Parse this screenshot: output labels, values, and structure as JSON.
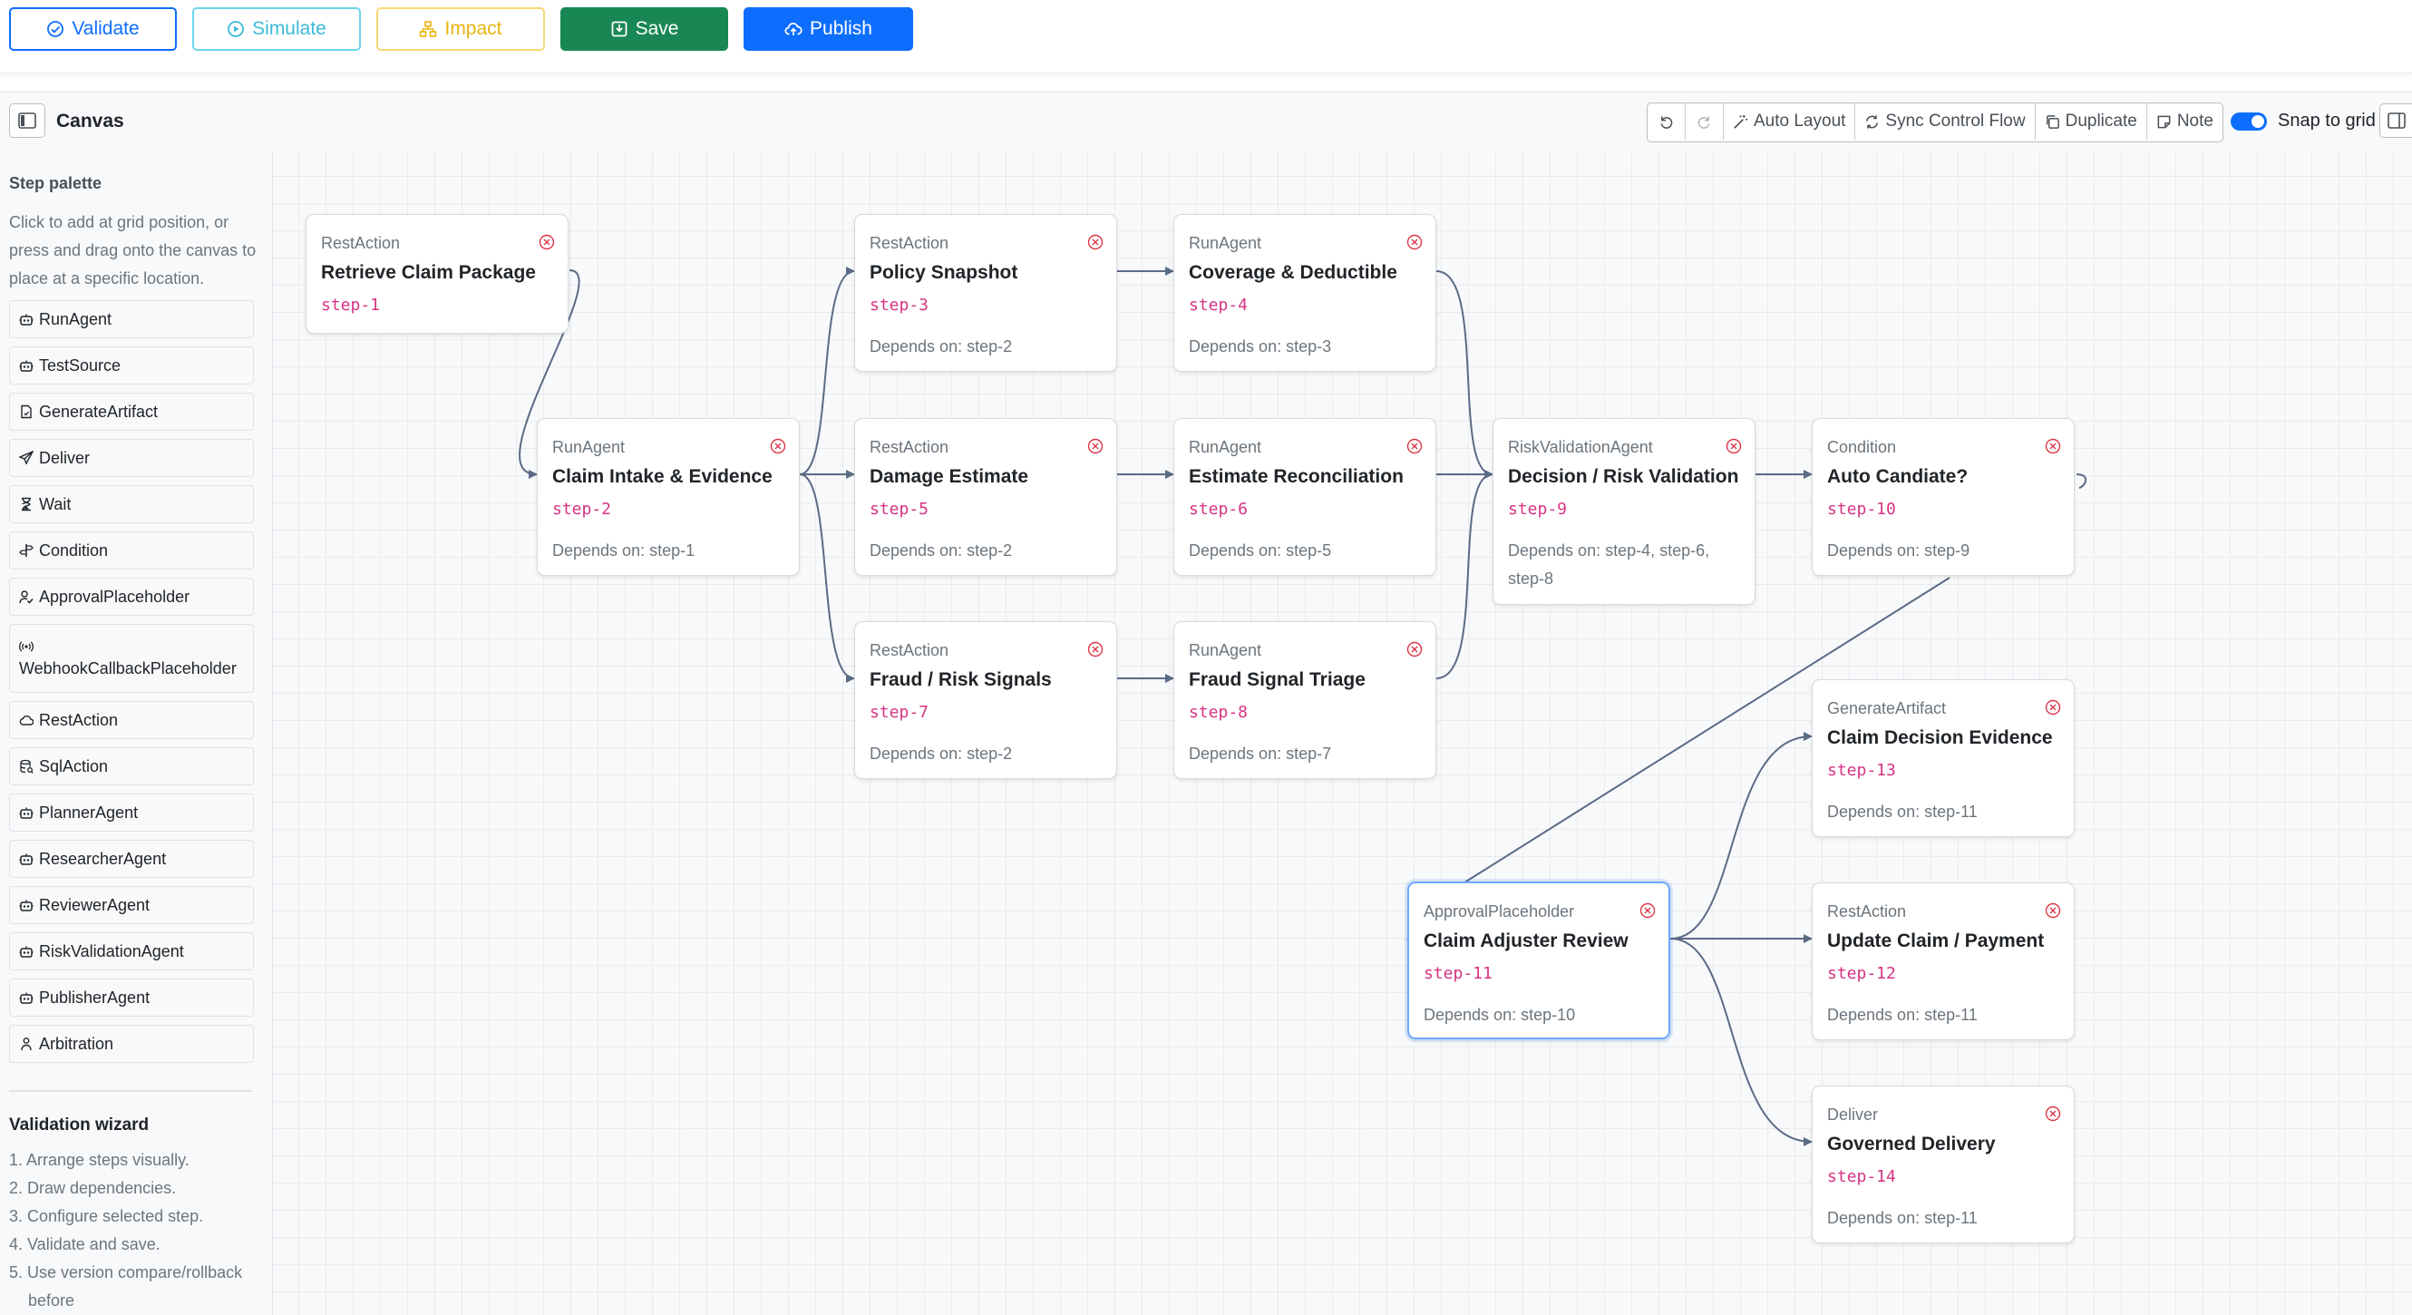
{
  "toolbar": {
    "validate": "Validate",
    "simulate": "Simulate",
    "impact": "Impact",
    "save": "Save",
    "publish": "Publish"
  },
  "canvas_header": {
    "title": "Canvas",
    "tools": {
      "undo_icon": "undo-icon",
      "redo_icon": "redo-icon",
      "auto_layout": "Auto Layout",
      "sync_control_flow": "Sync Control Flow",
      "duplicate": "Duplicate",
      "note": "Note"
    },
    "snap_to_grid": {
      "label": "Snap to grid",
      "enabled": true
    }
  },
  "sidebar": {
    "heading": "Step palette",
    "help": "Click to add at grid position, or press and drag onto the canvas to place at a specific location.",
    "palette": [
      {
        "label": "RunAgent",
        "icon": "robot-icon"
      },
      {
        "label": "TestSource",
        "icon": "robot-icon"
      },
      {
        "label": "GenerateArtifact",
        "icon": "file-icon"
      },
      {
        "label": "Deliver",
        "icon": "send-icon"
      },
      {
        "label": "Wait",
        "icon": "hourglass-icon"
      },
      {
        "label": "Condition",
        "icon": "signpost-icon"
      },
      {
        "label": "ApprovalPlaceholder",
        "icon": "person-check-icon"
      },
      {
        "label": "WebhookCallbackPlaceholder",
        "icon": "broadcast-icon"
      },
      {
        "label": "RestAction",
        "icon": "cloud-icon"
      },
      {
        "label": "SqlAction",
        "icon": "database-icon"
      },
      {
        "label": "PlannerAgent",
        "icon": "robot-icon"
      },
      {
        "label": "ResearcherAgent",
        "icon": "robot-icon"
      },
      {
        "label": "ReviewerAgent",
        "icon": "robot-icon"
      },
      {
        "label": "RiskValidationAgent",
        "icon": "robot-icon"
      },
      {
        "label": "PublisherAgent",
        "icon": "robot-icon"
      },
      {
        "label": "Arbitration",
        "icon": "people-icon"
      }
    ],
    "wizard": {
      "heading": "Validation wizard",
      "steps": [
        "1. Arrange steps visually.",
        "2. Draw dependencies.",
        "3. Configure selected step.",
        "4. Validate and save.",
        "5. Use version compare/rollback before"
      ]
    }
  },
  "nodes": [
    {
      "id": "step-1",
      "type": "RestAction",
      "title": "Retrieve Claim Package",
      "deps": ""
    },
    {
      "id": "step-2",
      "type": "RunAgent",
      "title": "Claim Intake & Evidence",
      "deps": "Depends on: step-1"
    },
    {
      "id": "step-3",
      "type": "RestAction",
      "title": "Policy Snapshot",
      "deps": "Depends on: step-2"
    },
    {
      "id": "step-4",
      "type": "RunAgent",
      "title": "Coverage & Deductible",
      "deps": "Depends on: step-3"
    },
    {
      "id": "step-5",
      "type": "RestAction",
      "title": "Damage Estimate",
      "deps": "Depends on: step-2"
    },
    {
      "id": "step-6",
      "type": "RunAgent",
      "title": "Estimate Reconciliation",
      "deps": "Depends on: step-5"
    },
    {
      "id": "step-7",
      "type": "RestAction",
      "title": "Fraud / Risk Signals",
      "deps": "Depends on: step-2"
    },
    {
      "id": "step-8",
      "type": "RunAgent",
      "title": "Fraud Signal Triage",
      "deps": "Depends on: step-7"
    },
    {
      "id": "step-9",
      "type": "RiskValidationAgent",
      "title": "Decision / Risk Validation",
      "deps": "Depends on: step-4, step-6, step-8"
    },
    {
      "id": "step-10",
      "type": "Condition",
      "title": "Auto Candiate?",
      "deps": "Depends on: step-9"
    },
    {
      "id": "step-11",
      "type": "ApprovalPlaceholder",
      "title": "Claim Adjuster Review",
      "deps": "Depends on: step-10",
      "selected": true
    },
    {
      "id": "step-13",
      "type": "GenerateArtifact",
      "title": "Claim Decision Evidence",
      "deps": "Depends on: step-11"
    },
    {
      "id": "step-12",
      "type": "RestAction",
      "title": "Update Claim / Payment",
      "deps": "Depends on: step-11"
    },
    {
      "id": "step-14",
      "type": "Deliver",
      "title": "Governed Delivery",
      "deps": "Depends on: step-11"
    }
  ],
  "colors": {
    "primary": "#0d6efd",
    "success": "#198754",
    "info": "#3dbad8",
    "warning": "#e9b40d",
    "step_id": "#d63384",
    "delete": "#dc3545",
    "edge": "#5a6b85"
  }
}
